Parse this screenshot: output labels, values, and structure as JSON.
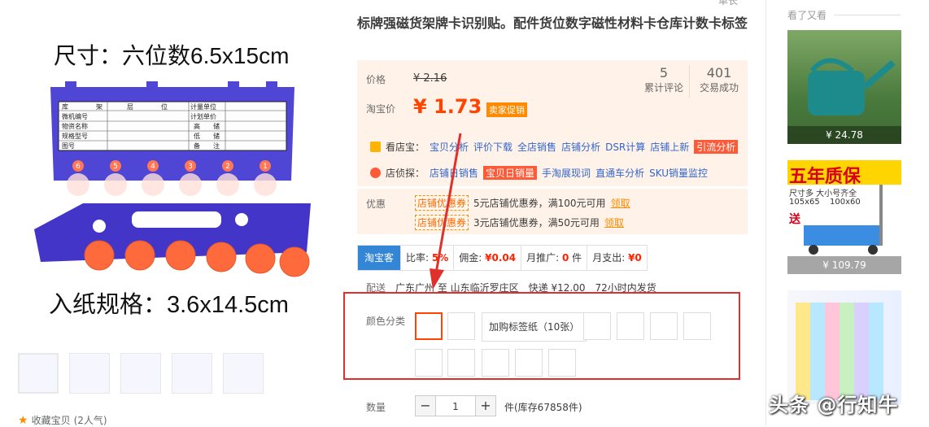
{
  "product": {
    "title": "标牌强磁货架牌卡识别贴。配件货位数字磁性材料卡仓库计数卡标签",
    "top_cut_text": "单长"
  },
  "image": {
    "size_text": "尺寸：六位数6.5x15cm",
    "paper_text": "入纸规格：3.6x14.5cm",
    "table_cells": [
      "库",
      "架",
      "层",
      "位",
      "计量单位",
      "微机编号",
      "计划单价",
      "物资名称",
      "高",
      "储",
      "规格型号",
      "低",
      "储",
      "图号",
      "备",
      "注"
    ],
    "digits": [
      "6",
      "5",
      "4",
      "3",
      "2",
      "1"
    ]
  },
  "price": {
    "label": "价格",
    "old": "¥ 2.16",
    "taobao_label": "淘宝价",
    "current": "¥ 1.73",
    "promo_tag": "卖家促销",
    "stats": [
      {
        "value": "5",
        "label": "累计评论"
      },
      {
        "value": "401",
        "label": "交易成功"
      }
    ]
  },
  "tools": {
    "row1": {
      "label": "看店宝：",
      "links": [
        "宝贝分析",
        "评价下载",
        "全店销售",
        "店铺分析",
        "DSR计算",
        "店铺上新"
      ],
      "hot": "引流分析"
    },
    "row2": {
      "label": "店侦探：",
      "links": [
        "店铺日销售"
      ],
      "hot": "宝贝日销量",
      "links_after": [
        "手淘展现词",
        "直通车分析",
        "SKU销量监控"
      ]
    }
  },
  "coupons": {
    "label": "优惠",
    "items": [
      {
        "tag": "店铺优惠券",
        "text": "5元店铺优惠券，满100元可用",
        "action": "领取"
      },
      {
        "tag": "店铺优惠券",
        "text": "3元店铺优惠券，满50元可用",
        "action": "领取"
      }
    ]
  },
  "metrics": {
    "badge": "淘宝客",
    "cells": [
      {
        "label": "比率:",
        "value": "5%"
      },
      {
        "label": "佣金:",
        "value": "¥0.04"
      },
      {
        "label": "月推广:",
        "value": "0",
        "suffix": "件"
      },
      {
        "label": "月支出:",
        "value": "¥0"
      }
    ]
  },
  "shipping": {
    "label": "配送",
    "route": "广东广州 至 山东临沂罗庄区",
    "fee": "快递 ¥12.00",
    "time": "72小时内发货"
  },
  "color": {
    "label": "颜色分类",
    "text_option": "加购标签纸（10张）",
    "swatch_count": 12
  },
  "quantity": {
    "label": "数量",
    "value": "1",
    "minus": "−",
    "plus": "+",
    "stock": "件(库存67858件)"
  },
  "favorite": {
    "text": "收藏宝贝",
    "count": "(2人气)"
  },
  "sidebar": {
    "title": "看了又看",
    "items": [
      {
        "price": "¥ 24.78"
      },
      {
        "price": "¥ 109.79",
        "ad_title": "五年质保",
        "ad_sub": "尺寸多 大小号齐全",
        "ad_sizes": [
          "105x65",
          "100x60"
        ],
        "ad_tag": "送"
      },
      {
        "price": ""
      }
    ]
  },
  "watermark": "头条 @行知牛",
  "colors": {
    "accent": "#ff4400",
    "link": "#3366cc",
    "price_bg": "#fff2e8",
    "badge_blue": "#3385d6",
    "highlight_red": "#e0302c"
  }
}
